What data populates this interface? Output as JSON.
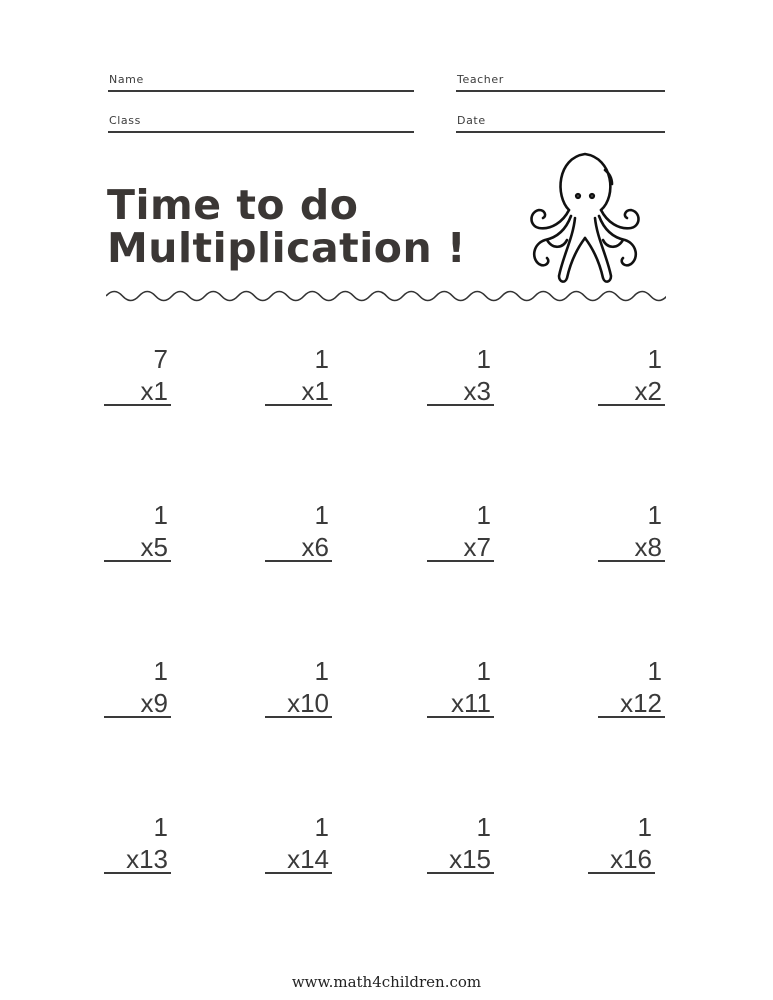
{
  "header": {
    "fields": [
      {
        "id": "name",
        "label": "Name"
      },
      {
        "id": "teacher",
        "label": "Teacher"
      },
      {
        "id": "class",
        "label": "Class"
      },
      {
        "id": "date",
        "label": "Date"
      }
    ]
  },
  "title": {
    "line1": "Time to do",
    "line2": "Multiplication !"
  },
  "illustration": {
    "icon": "octopus-icon"
  },
  "decoration": {
    "icon": "wave-divider"
  },
  "problems": [
    {
      "top": "7",
      "bottom": "x1"
    },
    {
      "top": "1",
      "bottom": "x1"
    },
    {
      "top": "1",
      "bottom": "x3"
    },
    {
      "top": "1",
      "bottom": "x2"
    },
    {
      "top": "1",
      "bottom": "x5"
    },
    {
      "top": "1",
      "bottom": "x6"
    },
    {
      "top": "1",
      "bottom": "x7"
    },
    {
      "top": "1",
      "bottom": "x8"
    },
    {
      "top": "1",
      "bottom": "x9"
    },
    {
      "top": "1",
      "bottom": "x10"
    },
    {
      "top": "1",
      "bottom": "x11"
    },
    {
      "top": "1",
      "bottom": "x12"
    },
    {
      "top": "1",
      "bottom": "x13"
    },
    {
      "top": "1",
      "bottom": "x14"
    },
    {
      "top": "1",
      "bottom": "x15"
    },
    {
      "top": "1",
      "bottom": "x16"
    }
  ],
  "footer": {
    "website": "www.math4children.com"
  },
  "colors": {
    "ink": "#3a3a3a",
    "title": "#3b3735",
    "background": "#ffffff"
  }
}
